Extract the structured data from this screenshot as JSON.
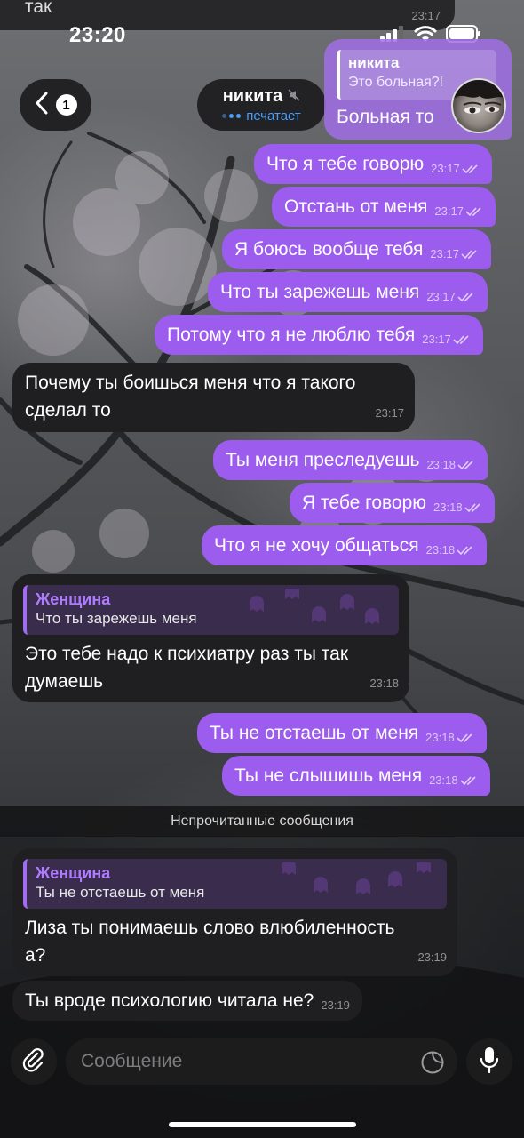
{
  "status": {
    "time": "23:20"
  },
  "top_partial": {
    "text": "так",
    "time": "23:17"
  },
  "header": {
    "back_count": "1",
    "name": "никита",
    "typing": "печатает"
  },
  "quoted_top": {
    "reply_name": "никита",
    "reply_text": "Это больная?!",
    "text": "Больная то"
  },
  "outgoing_1": [
    {
      "text": "Что я тебе говорю",
      "time": "23:17"
    },
    {
      "text": "Отстань от меня",
      "time": "23:17"
    },
    {
      "text": "Я боюсь вообще тебя",
      "time": "23:17"
    },
    {
      "text": "Что ты зарежешь меня",
      "time": "23:17"
    },
    {
      "text": "Потому что я не люблю тебя",
      "time": "23:17"
    }
  ],
  "incoming_1": {
    "line1": "Почему ты боишься меня что я такого",
    "line2": "сделал то",
    "time": "23:17"
  },
  "outgoing_2": [
    {
      "text": "Ты меня преследуешь",
      "time": "23:18"
    },
    {
      "text": "Я тебе говорю",
      "time": "23:18"
    },
    {
      "text": "Что я не хочу общаться",
      "time": "23:18"
    }
  ],
  "incoming_2": {
    "reply_name": "Женщина",
    "reply_text": "Что ты зарежешь меня",
    "line1": "Это тебе надо к психиатру раз ты так",
    "line2": "думаешь",
    "time": "23:18"
  },
  "outgoing_3": [
    {
      "text": "Ты не отстаешь от меня",
      "time": "23:18"
    },
    {
      "text": "Ты не слышишь меня",
      "time": "23:18"
    }
  ],
  "unread_label": "Непрочитанные сообщения",
  "incoming_3": {
    "reply_name": "Женщина",
    "reply_text": "Ты не отстаешь от меня",
    "line1": "Лиза ты понимаешь слово влюбиленность",
    "line2": "а?",
    "time": "23:19"
  },
  "incoming_4": {
    "text": "Ты вроде психологию читала не?",
    "time": "23:19"
  },
  "input": {
    "placeholder": "Сообщение"
  },
  "colors": {
    "outgoing": "#9c5ced",
    "incoming": "#1f1f21",
    "accent": "#4a9cf6",
    "reply_name": "#b07cff"
  },
  "icons": [
    "back-chevron-icon",
    "mute-icon",
    "paperclip-icon",
    "sticker-icon",
    "microphone-icon",
    "double-check-icon",
    "signal-icon",
    "wifi-icon",
    "battery-icon"
  ]
}
